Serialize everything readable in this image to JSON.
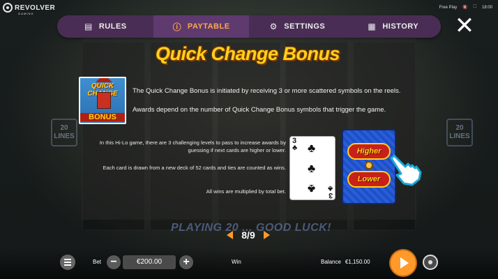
{
  "brand": {
    "name": "REVOLVER",
    "sub": "GAMING"
  },
  "top_right": {
    "mode": "Free Play",
    "time": "18:00"
  },
  "tabs": [
    {
      "label": "RULES",
      "icon": "book-icon"
    },
    {
      "label": "PAYTABLE",
      "icon": "info-icon"
    },
    {
      "label": "SETTINGS",
      "icon": "gear-icon"
    },
    {
      "label": "HISTORY",
      "icon": "calendar-icon"
    }
  ],
  "active_tab": "PAYTABLE",
  "panel": {
    "title": "Quick Change Bonus",
    "bonus_symbol": {
      "top": "QUICK CHANGE",
      "bottom": "BONUS"
    },
    "line1": "The Quick Change Bonus is initiated by receiving 3 or more scattered symbols on the reels.",
    "line2": "Awards depend on the number of Quick Change Bonus symbols that trigger the game.",
    "small1": "In this Hi-Lo game, there are 3 challenging levels to pass to increase awards by guessing if next cards are higher or lower.",
    "small2": "Each card is drawn from a new deck of 52 cards and ties are counted as wins.",
    "small3": "All wins are multiplied by total bet.",
    "card": {
      "rank": "3",
      "suit": "♣"
    },
    "hilo": {
      "higher": "Higher",
      "lower": "Lower"
    }
  },
  "background": {
    "lines_left": "20 LINES",
    "lines_right": "20 LINES",
    "banner": "PLAYING 20 ... GOOD LUCK!"
  },
  "pager": {
    "text": "8/9"
  },
  "bottom_bar": {
    "bet_label": "Bet",
    "bet_value": "€200.00",
    "minus": "−",
    "plus": "+",
    "win_label": "Win",
    "balance_label": "Balance",
    "balance_value": "€1,150.00"
  },
  "colors": {
    "accent": "#ffa84a",
    "tabbar": "#4a2d55",
    "title": "#ffd21a",
    "spin": "#ff9a2a"
  }
}
